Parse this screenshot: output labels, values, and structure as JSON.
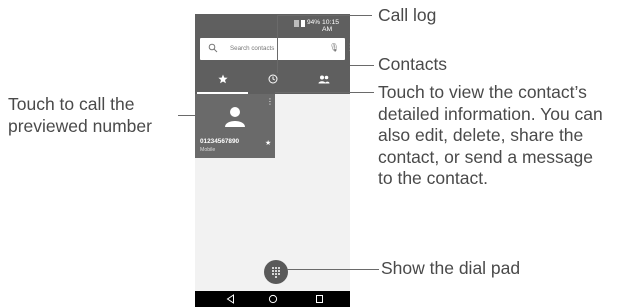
{
  "status_bar": {
    "battery": "94%",
    "time": "10:15 AM"
  },
  "search": {
    "placeholder": "Search contacts"
  },
  "tabs": [
    {
      "name": "favorites",
      "icon": "star-icon"
    },
    {
      "name": "call-log",
      "icon": "clock-icon"
    },
    {
      "name": "contacts",
      "icon": "people-icon"
    }
  ],
  "favorite_card": {
    "number": "01234567890",
    "type": "Mobile"
  },
  "annotations": {
    "call_log": "Call log",
    "contacts": "Contacts",
    "detail": [
      "Touch to view the contact’s",
      "detailed information. You can",
      "also edit, delete, share the",
      "contact, or send a message",
      "to the contact."
    ],
    "call_preview": [
      "Touch to call the",
      "previewed number"
    ],
    "dial_pad": "Show the dial pad"
  },
  "colors": {
    "dark_gray": "#5f5f5f",
    "card_gray": "#6a6a6a",
    "background": "#f2f2f2"
  }
}
